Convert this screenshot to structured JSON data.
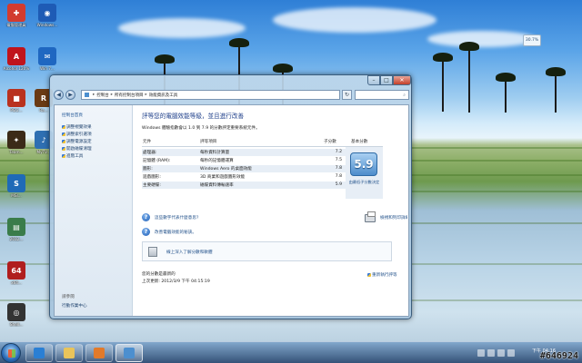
{
  "desktop": {
    "icons": [
      {
        "label": "電腦管理員",
        "color": "#d23b2f",
        "glyph": "✚"
      },
      {
        "label": "Windows...",
        "color": "#1e5bb5",
        "glyph": "◉"
      },
      {
        "label": "Alcohol 120%",
        "color": "#c0141c",
        "glyph": "A"
      },
      {
        "label": "Win 7...",
        "color": "#1f67c1",
        "glyph": "✉"
      },
      {
        "label": "PS/2...",
        "color": "#b9321f",
        "glyph": "■"
      },
      {
        "label": "Ra...",
        "color": "#6a3a14",
        "glyph": "R"
      },
      {
        "label": "Team...",
        "color": "#3b2a18",
        "glyph": "✦"
      },
      {
        "label": "MyTV...",
        "color": "#2e6fb2",
        "glyph": "♪"
      },
      {
        "label": "MSI...",
        "color": "#1f6ab7",
        "glyph": "S"
      },
      {
        "label": "2012...",
        "color": "#3a7c4a",
        "glyph": "▤"
      },
      {
        "label": "x64...",
        "color": "#b01e1e",
        "glyph": "64"
      },
      {
        "label": "Shell...",
        "color": "#333333",
        "glyph": "◎"
      }
    ],
    "gadget_text": "30.7%"
  },
  "window": {
    "caption_buttons": {
      "min": "–",
      "max": "□",
      "close": "✕"
    },
    "nav": {
      "back": "◀",
      "forward": "▶"
    },
    "address": [
      "控制台",
      "所有控制台項目",
      "效能資訊及工具"
    ],
    "refresh": "↻",
    "search_icon": "⌕",
    "left_pane": {
      "home": "控制台首頁",
      "links": [
        "調整視覺效果",
        "調整索引選項",
        "調整電源設定",
        "開啟磁碟清理",
        "進階工具"
      ],
      "see_also_title": "請參閱",
      "see_also": [
        "行動作業中心"
      ]
    },
    "main": {
      "title": "評等您的電腦效能等級，並且進行改善",
      "description": "Windows 體驗指數會以 1.0 到 7.9 的分數評定重要系統元件。",
      "table": {
        "col_component": "元件",
        "col_item": "評等項目",
        "col_subscore": "子分數",
        "col_base": "基本分數",
        "rows": [
          {
            "component": "處理器:",
            "item": "每秒資料計算量",
            "score": "7.2"
          },
          {
            "component": "記憶體 (RAM):",
            "item": "每秒的記憶體運算",
            "score": "7.5"
          },
          {
            "component": "圖形:",
            "item": "Windows Aero 的桌面效能",
            "score": "7.8"
          },
          {
            "component": "遊戲圖形:",
            "item": "3D 商業和遊戲圖形效能",
            "score": "7.8"
          },
          {
            "component": "主要硬碟:",
            "item": "磁碟資料傳輸速率",
            "score": "5.9"
          }
        ],
        "base_score": "5.9",
        "base_caption": "由最低子分數決定"
      },
      "links": [
        "這些數字代表什麼意思?",
        "改善電腦效能的秘訣。"
      ],
      "link_right": "檢視和列印詳細的效能及系統資訊",
      "tips": "線上深入了解分數和軟體",
      "last_rated_title": "您的分數是最新的",
      "last_update": "上次更新: 2012/3/9 下午 04:15:19",
      "rerun": "重新執行評等"
    }
  },
  "taskbar": {
    "pinned": [
      {
        "name": "ie-icon",
        "color": "#2a7fd4"
      },
      {
        "name": "explorer-folder-icon",
        "color": "#e9c45a"
      },
      {
        "name": "media-player-icon",
        "color": "#e27a2a"
      },
      {
        "name": "control-panel-icon",
        "color": "#4c8fcf"
      }
    ],
    "clock": "下午 04:16"
  },
  "watermark": "#646924"
}
